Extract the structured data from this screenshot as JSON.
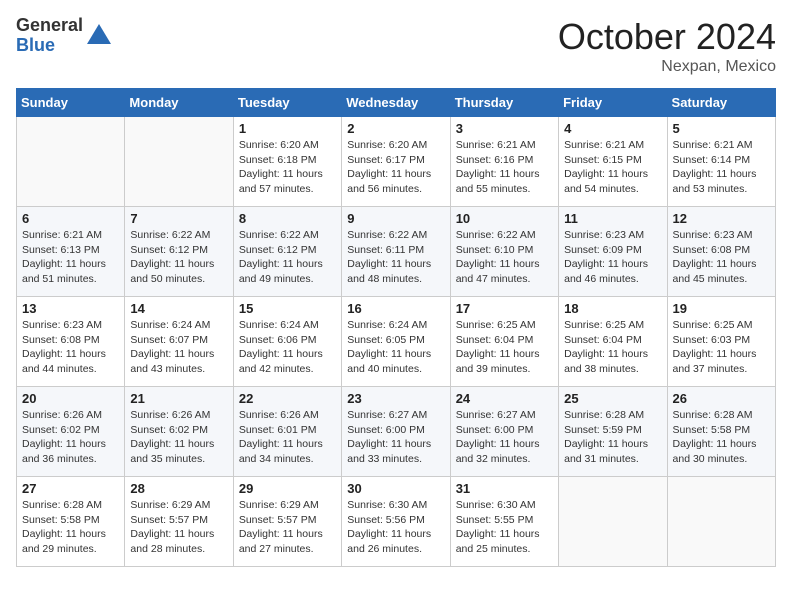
{
  "logo": {
    "general": "General",
    "blue": "Blue"
  },
  "title": "October 2024",
  "location": "Nexpan, Mexico",
  "days_of_week": [
    "Sunday",
    "Monday",
    "Tuesday",
    "Wednesday",
    "Thursday",
    "Friday",
    "Saturday"
  ],
  "weeks": [
    [
      {
        "day": "",
        "info": ""
      },
      {
        "day": "",
        "info": ""
      },
      {
        "day": "1",
        "info": "Sunrise: 6:20 AM\nSunset: 6:18 PM\nDaylight: 11 hours and 57 minutes."
      },
      {
        "day": "2",
        "info": "Sunrise: 6:20 AM\nSunset: 6:17 PM\nDaylight: 11 hours and 56 minutes."
      },
      {
        "day": "3",
        "info": "Sunrise: 6:21 AM\nSunset: 6:16 PM\nDaylight: 11 hours and 55 minutes."
      },
      {
        "day": "4",
        "info": "Sunrise: 6:21 AM\nSunset: 6:15 PM\nDaylight: 11 hours and 54 minutes."
      },
      {
        "day": "5",
        "info": "Sunrise: 6:21 AM\nSunset: 6:14 PM\nDaylight: 11 hours and 53 minutes."
      }
    ],
    [
      {
        "day": "6",
        "info": "Sunrise: 6:21 AM\nSunset: 6:13 PM\nDaylight: 11 hours and 51 minutes."
      },
      {
        "day": "7",
        "info": "Sunrise: 6:22 AM\nSunset: 6:12 PM\nDaylight: 11 hours and 50 minutes."
      },
      {
        "day": "8",
        "info": "Sunrise: 6:22 AM\nSunset: 6:12 PM\nDaylight: 11 hours and 49 minutes."
      },
      {
        "day": "9",
        "info": "Sunrise: 6:22 AM\nSunset: 6:11 PM\nDaylight: 11 hours and 48 minutes."
      },
      {
        "day": "10",
        "info": "Sunrise: 6:22 AM\nSunset: 6:10 PM\nDaylight: 11 hours and 47 minutes."
      },
      {
        "day": "11",
        "info": "Sunrise: 6:23 AM\nSunset: 6:09 PM\nDaylight: 11 hours and 46 minutes."
      },
      {
        "day": "12",
        "info": "Sunrise: 6:23 AM\nSunset: 6:08 PM\nDaylight: 11 hours and 45 minutes."
      }
    ],
    [
      {
        "day": "13",
        "info": "Sunrise: 6:23 AM\nSunset: 6:08 PM\nDaylight: 11 hours and 44 minutes."
      },
      {
        "day": "14",
        "info": "Sunrise: 6:24 AM\nSunset: 6:07 PM\nDaylight: 11 hours and 43 minutes."
      },
      {
        "day": "15",
        "info": "Sunrise: 6:24 AM\nSunset: 6:06 PM\nDaylight: 11 hours and 42 minutes."
      },
      {
        "day": "16",
        "info": "Sunrise: 6:24 AM\nSunset: 6:05 PM\nDaylight: 11 hours and 40 minutes."
      },
      {
        "day": "17",
        "info": "Sunrise: 6:25 AM\nSunset: 6:04 PM\nDaylight: 11 hours and 39 minutes."
      },
      {
        "day": "18",
        "info": "Sunrise: 6:25 AM\nSunset: 6:04 PM\nDaylight: 11 hours and 38 minutes."
      },
      {
        "day": "19",
        "info": "Sunrise: 6:25 AM\nSunset: 6:03 PM\nDaylight: 11 hours and 37 minutes."
      }
    ],
    [
      {
        "day": "20",
        "info": "Sunrise: 6:26 AM\nSunset: 6:02 PM\nDaylight: 11 hours and 36 minutes."
      },
      {
        "day": "21",
        "info": "Sunrise: 6:26 AM\nSunset: 6:02 PM\nDaylight: 11 hours and 35 minutes."
      },
      {
        "day": "22",
        "info": "Sunrise: 6:26 AM\nSunset: 6:01 PM\nDaylight: 11 hours and 34 minutes."
      },
      {
        "day": "23",
        "info": "Sunrise: 6:27 AM\nSunset: 6:00 PM\nDaylight: 11 hours and 33 minutes."
      },
      {
        "day": "24",
        "info": "Sunrise: 6:27 AM\nSunset: 6:00 PM\nDaylight: 11 hours and 32 minutes."
      },
      {
        "day": "25",
        "info": "Sunrise: 6:28 AM\nSunset: 5:59 PM\nDaylight: 11 hours and 31 minutes."
      },
      {
        "day": "26",
        "info": "Sunrise: 6:28 AM\nSunset: 5:58 PM\nDaylight: 11 hours and 30 minutes."
      }
    ],
    [
      {
        "day": "27",
        "info": "Sunrise: 6:28 AM\nSunset: 5:58 PM\nDaylight: 11 hours and 29 minutes."
      },
      {
        "day": "28",
        "info": "Sunrise: 6:29 AM\nSunset: 5:57 PM\nDaylight: 11 hours and 28 minutes."
      },
      {
        "day": "29",
        "info": "Sunrise: 6:29 AM\nSunset: 5:57 PM\nDaylight: 11 hours and 27 minutes."
      },
      {
        "day": "30",
        "info": "Sunrise: 6:30 AM\nSunset: 5:56 PM\nDaylight: 11 hours and 26 minutes."
      },
      {
        "day": "31",
        "info": "Sunrise: 6:30 AM\nSunset: 5:55 PM\nDaylight: 11 hours and 25 minutes."
      },
      {
        "day": "",
        "info": ""
      },
      {
        "day": "",
        "info": ""
      }
    ]
  ]
}
